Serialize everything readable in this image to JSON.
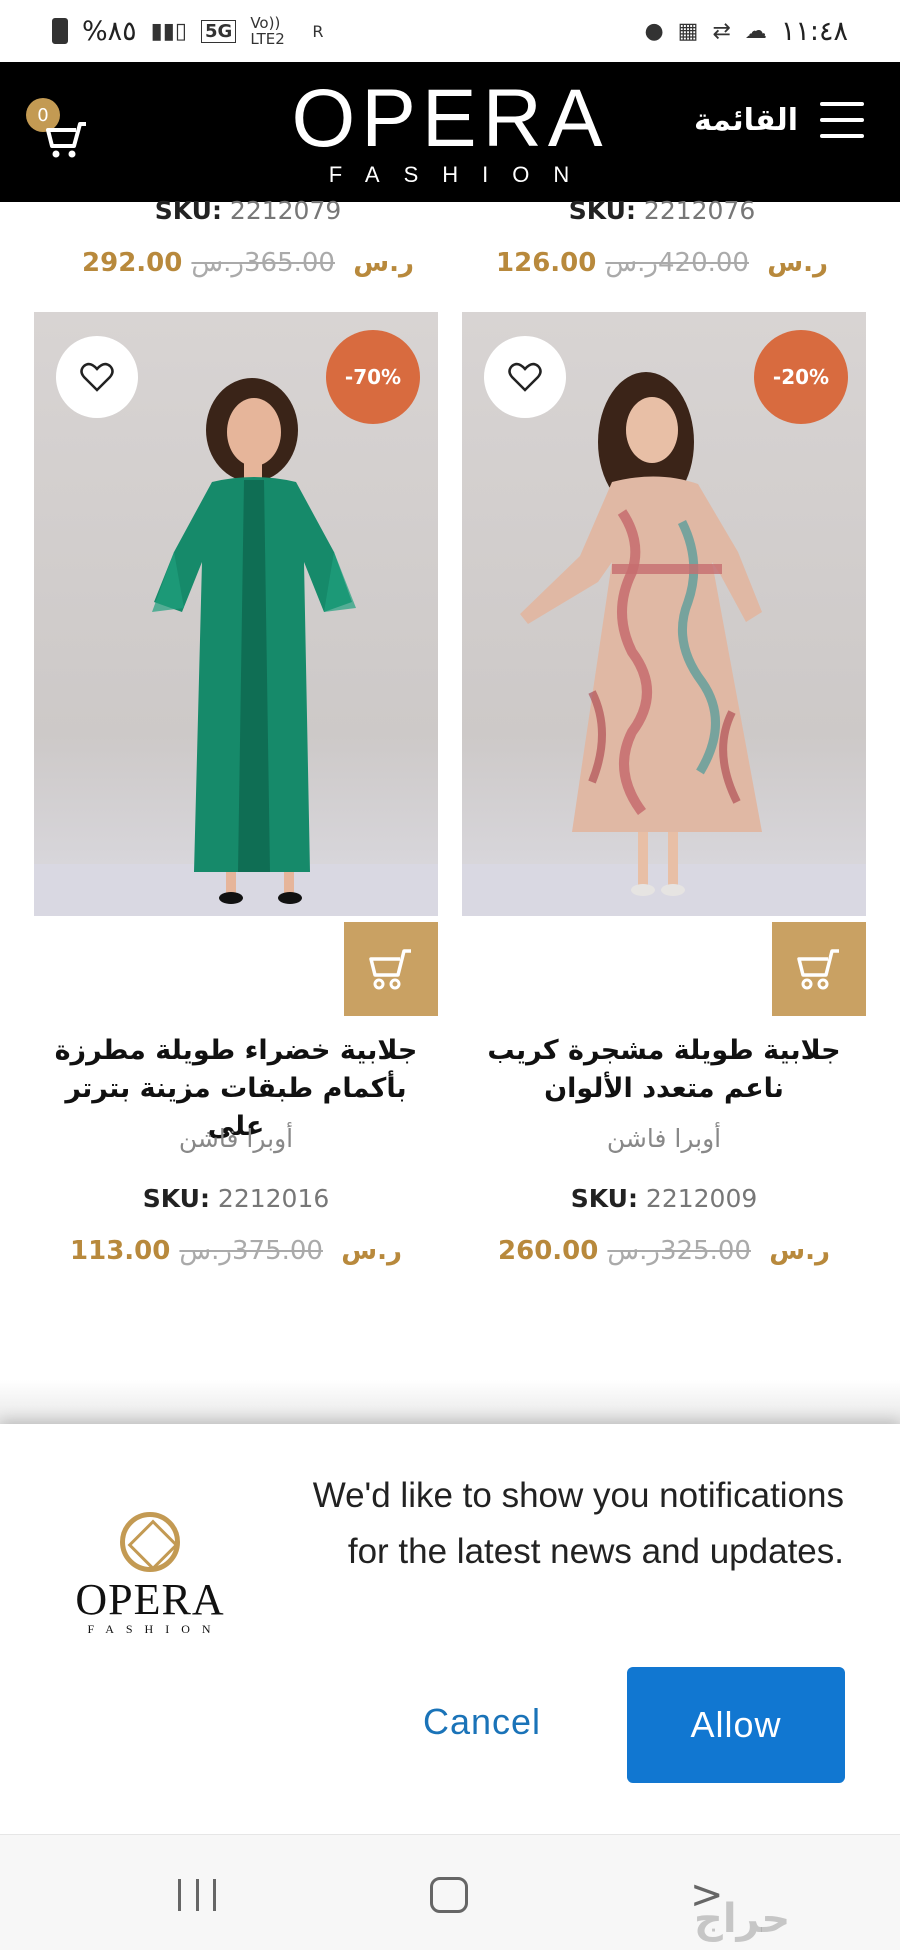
{
  "status_bar": {
    "battery": "%٨٥",
    "network_5g": "5G",
    "network_lte": "Vo)) LTE2",
    "roaming": "R",
    "time": "١١:٤٨"
  },
  "header": {
    "menu_label": "القائمة",
    "logo_main": "OPERA",
    "logo_sub": "FASHION",
    "cart_count": "0",
    "background": "#000000"
  },
  "previous_row": [
    {
      "sku_label": "SKU:",
      "sku": "2212079",
      "old_price": "365.00ر.س",
      "new_price": "292.00 ر.س"
    },
    {
      "sku_label": "SKU:",
      "sku": "2212076",
      "old_price": "420.00ر.س",
      "new_price": "126.00 ر.س"
    }
  ],
  "products": [
    {
      "discount": "-70%",
      "name": "جلابية خضراء طويلة مطرزة بأكمام طبقات مزينة بترتر على",
      "brand": "أوبرا فاشن",
      "sku_label": "SKU:",
      "sku": "2212016",
      "old_price": "375.00ر.س",
      "new_price": "113.00 ر.س",
      "dress_color": "#168a6a"
    },
    {
      "discount": "-20%",
      "name": "جلابية طويلة مشجرة كريب ناعم متعدد الألوان",
      "brand": "أوبرا فاشن",
      "sku_label": "SKU:",
      "sku": "2212009",
      "old_price": "325.00ر.س",
      "new_price": "260.00 ر.س",
      "dress_color": "#e0b8a4"
    }
  ],
  "notification_prompt": {
    "logo_main": "OPERA",
    "logo_sub": "FASHION",
    "message": "We'd like to show you notifications for the latest news and updates.",
    "cancel_label": "Cancel",
    "allow_label": "Allow",
    "allow_color": "#1177d1"
  },
  "colors": {
    "accent_gold": "#c9a163",
    "discount_orange": "#d86b3f",
    "price_gold": "#b8893c"
  },
  "watermark": "حراج"
}
